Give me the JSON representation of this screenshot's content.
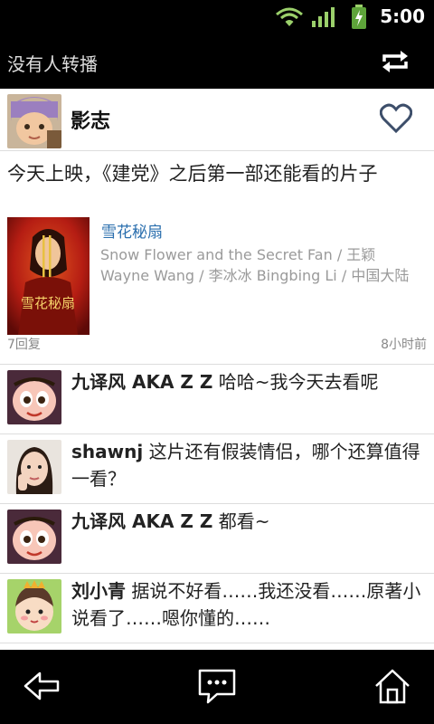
{
  "status": {
    "time": "5:00"
  },
  "titlebar": {
    "title": "没有人转播"
  },
  "post": {
    "author": "影志",
    "text": "今天上映，《建党》之后第一部还能看的片子",
    "movie": {
      "title": "雪花秘扇",
      "info": "Snow Flower and the Secret Fan / 王颖\nWayne Wang / 李冰冰 Bingbing Li / 中国大陆",
      "poster_text": "雪花秘扇"
    },
    "replies": "7回复",
    "time": "8小时前"
  },
  "comments": [
    {
      "name": "九译风 AKA Z Z",
      "text": " 哈哈~我今天去看呢"
    },
    {
      "name": "shawnj",
      "text": " 这片还有假装情侣，哪个还算值得一看？"
    },
    {
      "name": "九译风 AKA Z Z",
      "text": " 都看~"
    },
    {
      "name": "刘小青",
      "text": " 据说不好看……我还没看……原著小说看了……嗯你懂的……"
    }
  ],
  "colors": {
    "bar": "#000000",
    "link": "#2b6fae",
    "meta": "#888888",
    "divider": "#dddddd"
  },
  "icons": [
    "wifi-icon",
    "signal-icon",
    "battery-icon",
    "repost-icon",
    "heart-icon",
    "back-icon",
    "message-icon",
    "home-icon"
  ]
}
